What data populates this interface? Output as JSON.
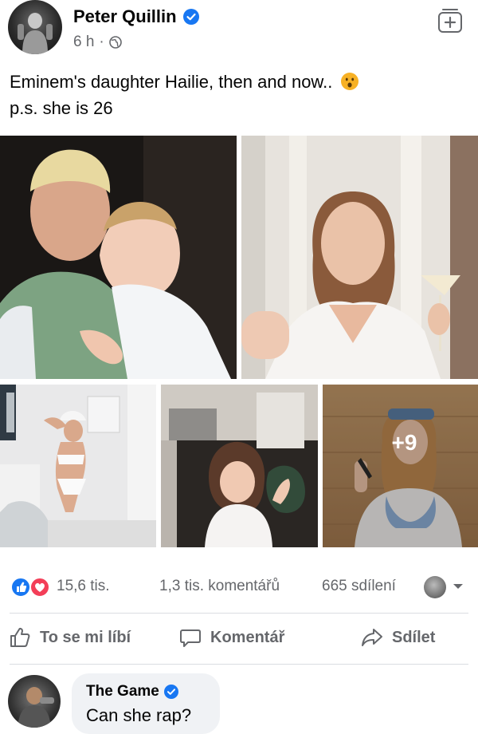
{
  "post": {
    "author": "Peter Quillin",
    "time": "6 h",
    "separator": "·",
    "text_line1": "Eminem's daughter Hailie, then and now..",
    "text_line2": "p.s. she is 26",
    "emoji": "hushed-face-emoji"
  },
  "gallery": {
    "more_count": "+9"
  },
  "stats": {
    "reactions": "15,6 tis.",
    "comments": "1,3 tis. komentářů",
    "shares": "665 sdílení"
  },
  "actions": {
    "like": "To se mi líbí",
    "comment": "Komentář",
    "share": "Sdílet"
  },
  "comment": {
    "author": "The Game",
    "text": "Can she rap?"
  },
  "colors": {
    "fb_blue": "#1877f2",
    "love_red": "#f33e58",
    "muted_text": "#65676b"
  }
}
